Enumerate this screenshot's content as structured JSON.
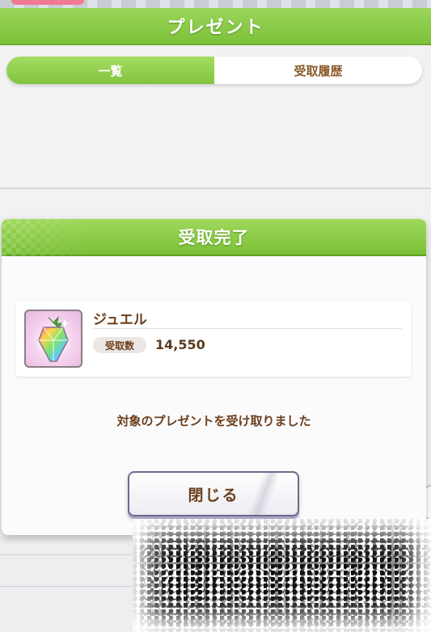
{
  "background_screen": {
    "header_title": "プレゼント",
    "tabs": [
      {
        "label": "一覧",
        "active": true
      },
      {
        "label": "受取履歴",
        "active": false
      }
    ]
  },
  "dialog": {
    "title": "受取完了",
    "item": {
      "name": "ジュエル",
      "quantity_label": "受取数",
      "quantity": "14,550",
      "icon": "jewel-icon"
    },
    "message": "対象のプレゼントを受け取りました",
    "close_label": "閉じる"
  },
  "colors": {
    "header_green": "#8bcb47",
    "text_brown": "#6b3f1d",
    "button_border": "#6f6a8c"
  }
}
